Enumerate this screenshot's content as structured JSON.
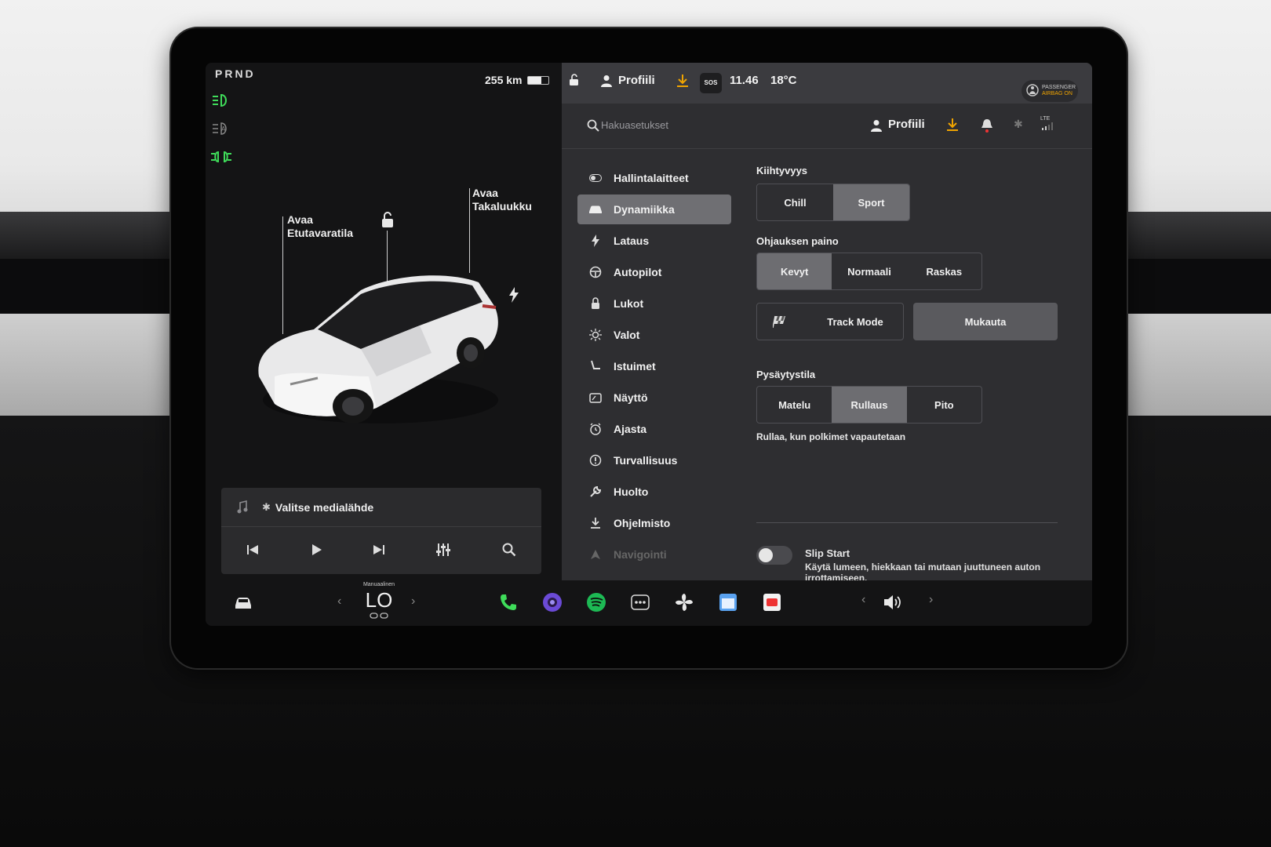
{
  "left_panel": {
    "gear": "PRND",
    "range": "255 km",
    "battery_level": 0.65,
    "labels": {
      "frunk_line1": "Avaa",
      "frunk_line2": "Etutavaratila",
      "trunk_line1": "Avaa",
      "trunk_line2": "Takaluukku"
    }
  },
  "media": {
    "source_label": "Valitse medialähde"
  },
  "status_bar": {
    "profile": "Profiili",
    "sos": "SOS",
    "time": "11.46",
    "temperature": "18°C",
    "airbag_line1": "PASSENGER",
    "airbag_line2": "AIRBAG ON"
  },
  "header": {
    "search_placeholder": "Hakuasetukset",
    "profile": "Profiili",
    "lte": "LTE"
  },
  "nav": {
    "items": [
      {
        "label": "Hallintalaitteet",
        "icon": "toggle-icon"
      },
      {
        "label": "Dynamiikka",
        "icon": "car-icon"
      },
      {
        "label": "Lataus",
        "icon": "bolt-icon"
      },
      {
        "label": "Autopilot",
        "icon": "steering-wheel-icon"
      },
      {
        "label": "Lukot",
        "icon": "lock-icon"
      },
      {
        "label": "Valot",
        "icon": "sun-icon"
      },
      {
        "label": "Istuimet",
        "icon": "seat-icon"
      },
      {
        "label": "Näyttö",
        "icon": "display-icon"
      },
      {
        "label": "Ajasta",
        "icon": "clock-icon"
      },
      {
        "label": "Turvallisuus",
        "icon": "warning-icon"
      },
      {
        "label": "Huolto",
        "icon": "wrench-icon"
      },
      {
        "label": "Ohjelmisto",
        "icon": "download-icon"
      },
      {
        "label": "Navigointi",
        "icon": "navigation-icon"
      }
    ],
    "active_index": 1
  },
  "dynamics": {
    "acceleration": {
      "title": "Kiihtyvyys",
      "options": [
        "Chill",
        "Sport"
      ],
      "selected": "Sport"
    },
    "steering": {
      "title": "Ohjauksen paino",
      "options": [
        "Kevyt",
        "Normaali",
        "Raskas"
      ],
      "selected": "Kevyt"
    },
    "track_mode": "Track Mode",
    "customize": "Mukauta",
    "stopping": {
      "title": "Pysäytystila",
      "options": [
        "Matelu",
        "Rullaus",
        "Pito"
      ],
      "selected": "Rullaus",
      "description": "Rullaa, kun polkimet vapautetaan"
    },
    "slip_start": {
      "title": "Slip Start",
      "description": "Käytä lumeen, hiekkaan tai mutaan juuttuneen auton irrottamiseen.",
      "enabled": false
    }
  },
  "bottom_bar": {
    "climate_mode": "Manuaalinen",
    "temperature": "LO"
  },
  "colors": {
    "accent_green": "#3fdc5a",
    "download_orange": "#f0a400",
    "selected_segment": "#6d6d71"
  }
}
